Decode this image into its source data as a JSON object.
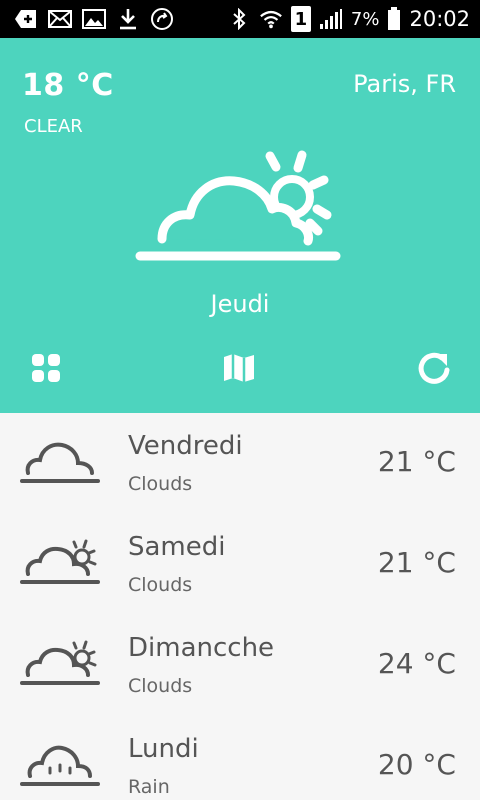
{
  "status_bar": {
    "icons_left": [
      "add-notification-icon",
      "mail-icon",
      "image-icon",
      "download-icon",
      "sync-icon"
    ],
    "icons_right": [
      "bluetooth-icon",
      "wifi-icon",
      "sim-icon",
      "signal-icon",
      "battery-icon"
    ],
    "sim_label": "1",
    "battery_percent": "7%",
    "time": "20:02"
  },
  "current": {
    "temperature": "18 °C",
    "condition": "CLEAR",
    "location": "Paris, FR",
    "day": "Jeudi",
    "icon": "cloud-sun-icon"
  },
  "toolbar": {
    "grid_icon": "grid-icon",
    "map_icon": "map-icon",
    "refresh_icon": "refresh-icon"
  },
  "forecast": [
    {
      "day": "Vendredi",
      "description": "Clouds",
      "temperature": "21 °C",
      "icon": "cloud-icon"
    },
    {
      "day": "Samedi",
      "description": "Clouds",
      "temperature": "21 °C",
      "icon": "cloud-sun-icon"
    },
    {
      "day": "Dimancche",
      "description": "Clouds",
      "temperature": "24 °C",
      "icon": "cloud-sun-icon"
    },
    {
      "day": "Lundi",
      "description": "Rain",
      "temperature": "20 °C",
      "icon": "rain-cloud-icon"
    }
  ],
  "colors": {
    "header": "#4dd4be",
    "list_background": "#f6f6f6",
    "list_text": "#555555"
  }
}
